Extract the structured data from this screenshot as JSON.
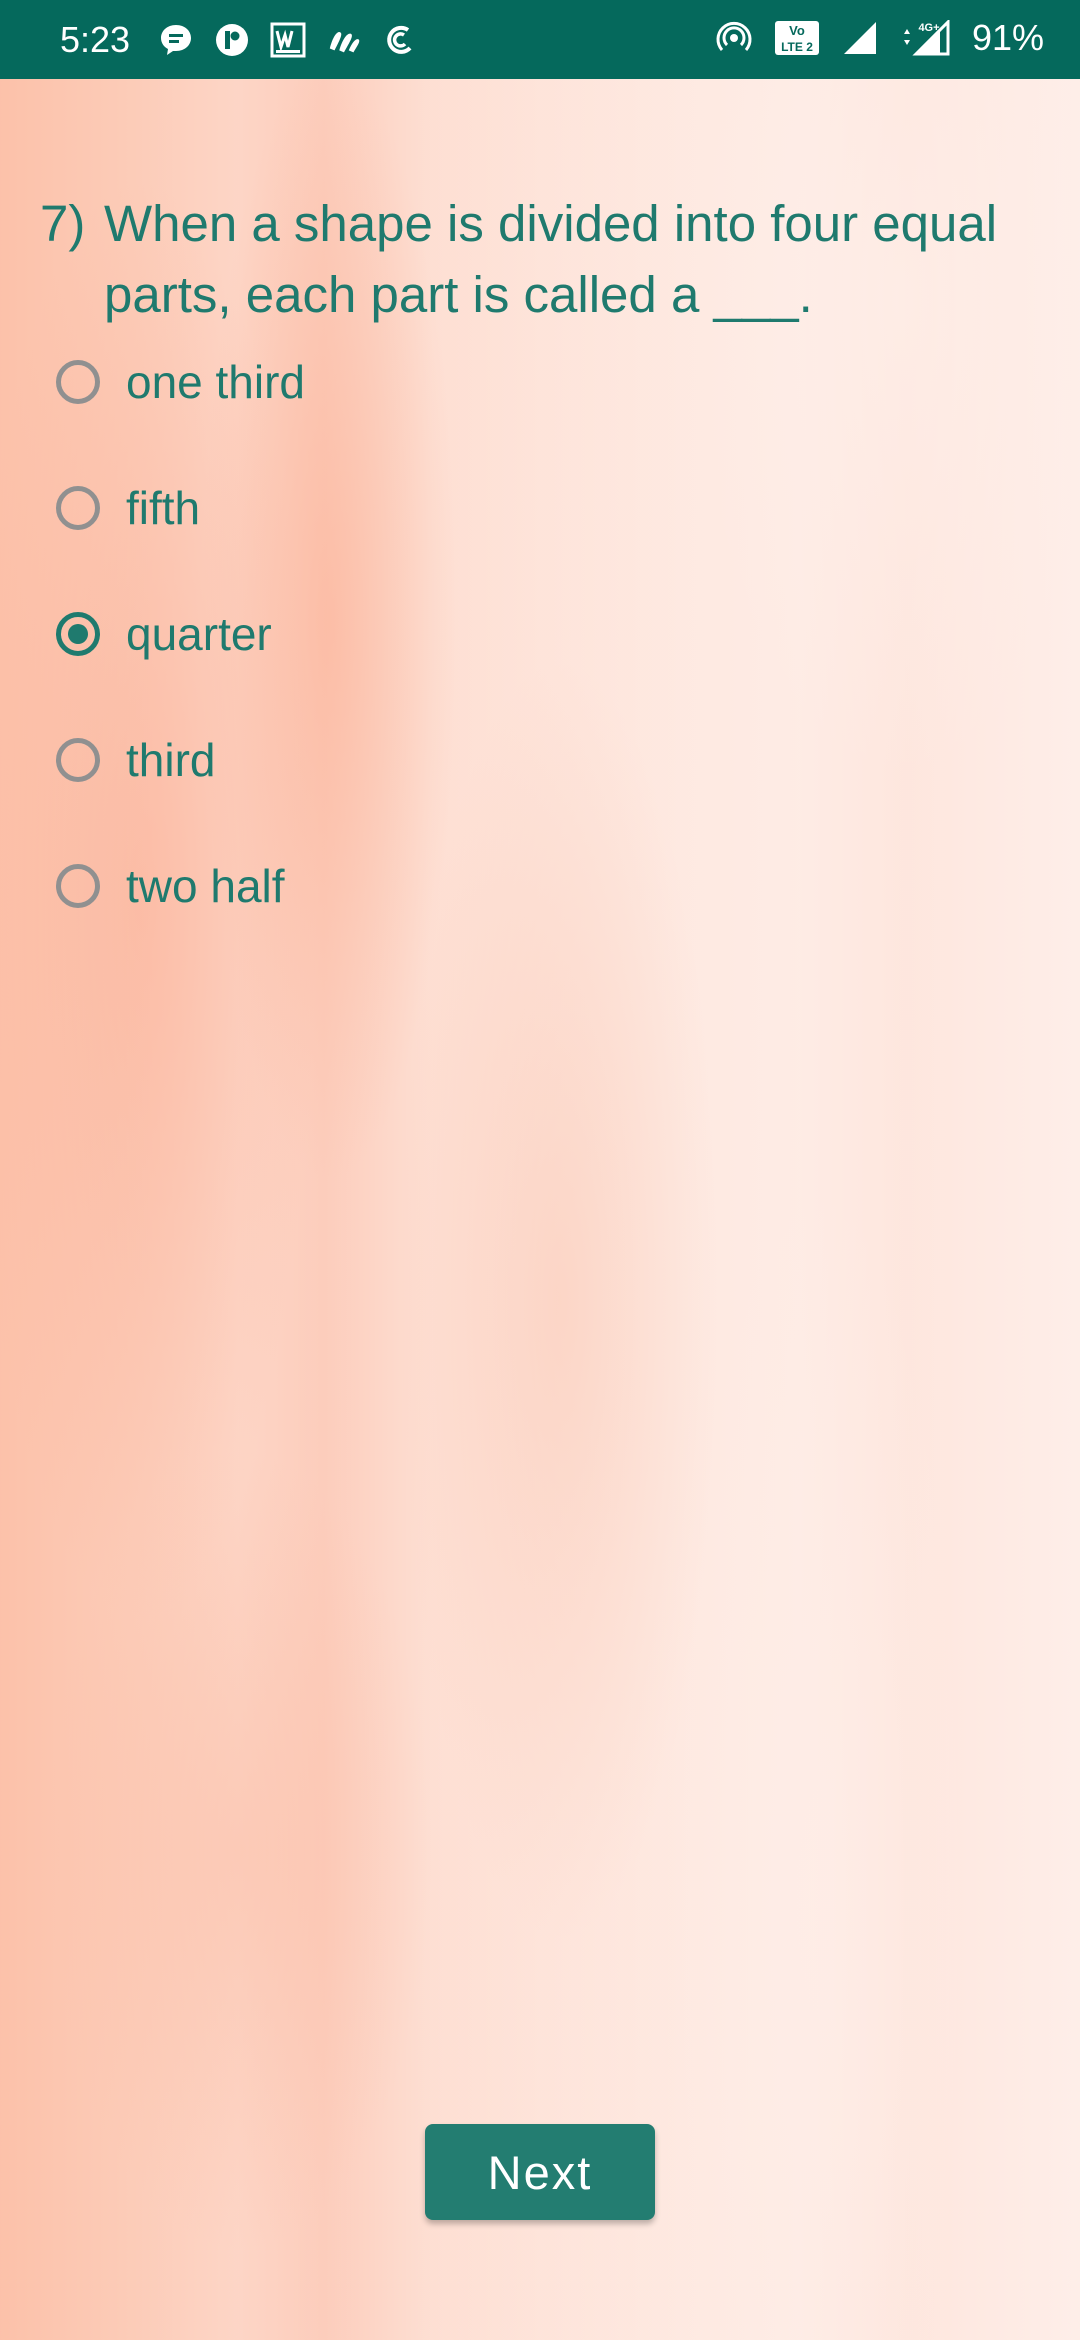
{
  "status_bar": {
    "time": "5:23",
    "battery": "91%",
    "left_icons": [
      "chat-bubble-icon",
      "notification-app-icon",
      "word-app-icon",
      "app-icon",
      "sync-app-icon"
    ],
    "right_icons": [
      "hotspot-icon",
      "volte-lte2-icon",
      "signal-icon",
      "4g-signal-icon"
    ],
    "volte_label": "Vo LTE 2",
    "network_label": "4G+"
  },
  "quiz": {
    "question_number": "7)",
    "question_text": "When a shape is divided into four equal parts, each part is called a ___.",
    "options": [
      {
        "label": "one third",
        "selected": false
      },
      {
        "label": "fifth",
        "selected": false
      },
      {
        "label": "quarter",
        "selected": true
      },
      {
        "label": "third",
        "selected": false
      },
      {
        "label": "two half",
        "selected": false
      }
    ],
    "next_label": "Next"
  },
  "colors": {
    "status_bar": "#05695c",
    "accent": "#1f7a6e",
    "button": "#237d71",
    "radio_unselected": "#909090"
  }
}
